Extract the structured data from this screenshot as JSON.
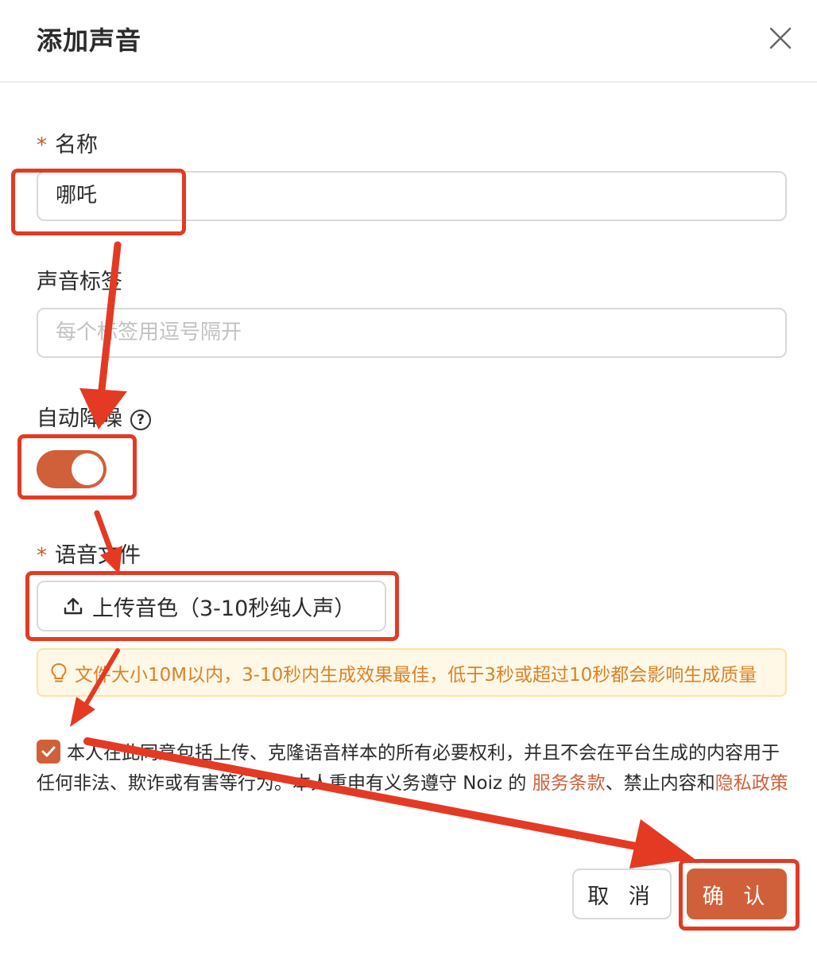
{
  "dialog": {
    "title": "添加声音",
    "close_icon": "close-icon"
  },
  "form": {
    "name": {
      "required_mark": "*",
      "label": "名称",
      "value": "哪吒"
    },
    "tags": {
      "label": "声音标签",
      "placeholder": "每个标签用逗号隔开"
    },
    "denoise": {
      "label": "自动降噪",
      "help_icon": "question-circle-icon",
      "help_glyph": "?",
      "enabled": true
    },
    "voice_file": {
      "required_mark": "*",
      "label": "语音文件",
      "upload_icon": "upload-icon",
      "upload_label": "上传音色（3-10秒纯人声）"
    },
    "tip": {
      "icon": "lightbulb-icon",
      "text": "文件大小10M以内，3-10秒内生成效果最佳，低于3秒或超过10秒都会影响生成质量"
    },
    "agreement": {
      "checked": true,
      "text_before": "本人在此同意包括上传、克隆语音样本的所有必要权利，并且不会在平台生成的内容用于任何非法、欺诈或有害等行为。本人重申有义务遵守 Noiz 的 ",
      "link_terms": "服务条款",
      "text_middle": "、禁止内容和",
      "link_privacy": "隐私政策"
    }
  },
  "footer": {
    "cancel_label": "取 消",
    "confirm_label": "确 认"
  },
  "colors": {
    "accent": "#d0603a",
    "annotation": "#e43a23",
    "tip_text": "#d9822b",
    "tip_bg": "#fff8e6"
  }
}
